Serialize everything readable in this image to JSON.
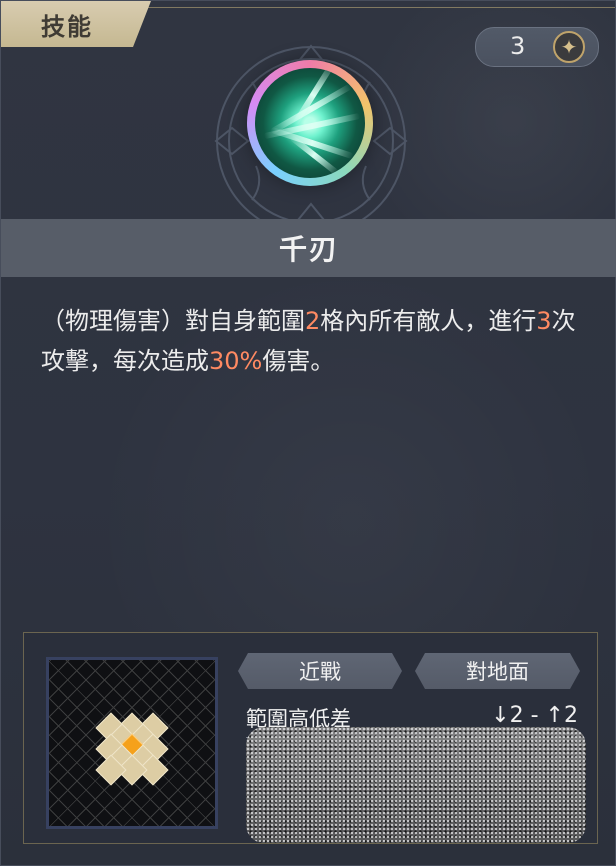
{
  "panel": {
    "header_label": "技能",
    "cost_value": "3"
  },
  "skill": {
    "name": "千刃",
    "description_segments": [
      "（物理傷害）對自身範圍",
      "2",
      "格內所有敵人，進行",
      "3",
      "次攻擊，每次造成",
      "30%",
      "傷害。"
    ]
  },
  "attributes": {
    "type_label": "近戰",
    "target_label": "對地面",
    "height_label": "範圍高低差",
    "height_value": "↓2 - ↑2"
  },
  "range_pattern": {
    "cells": [
      [
        0,
        -2
      ],
      [
        -1,
        -1
      ],
      [
        0,
        -1
      ],
      [
        1,
        -1
      ],
      [
        -2,
        0
      ],
      [
        -1,
        0
      ],
      [
        0,
        0
      ],
      [
        1,
        0
      ],
      [
        2,
        0
      ],
      [
        -1,
        1
      ],
      [
        0,
        1
      ],
      [
        1,
        1
      ],
      [
        0,
        2
      ]
    ],
    "center": [
      0,
      0
    ]
  },
  "icons": {
    "cost_icon": "star-icon",
    "skill_icon": "sword-slash-icon"
  }
}
